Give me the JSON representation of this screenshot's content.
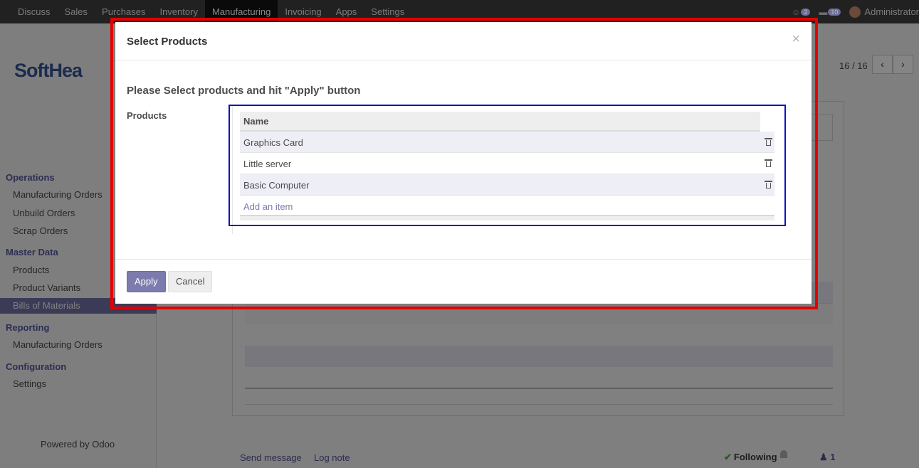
{
  "topbar": {
    "menu": [
      "Discuss",
      "Sales",
      "Purchases",
      "Inventory",
      "Manufacturing",
      "Invoicing",
      "Apps",
      "Settings"
    ],
    "active": "Manufacturing",
    "chat_count": "2",
    "activity_count": "10",
    "user": "Administrator"
  },
  "sidebar": {
    "logo": "SoftHea",
    "sections": [
      {
        "title": "Operations",
        "items": [
          "Manufacturing Orders",
          "Unbuild Orders",
          "Scrap Orders"
        ]
      },
      {
        "title": "Master Data",
        "items": [
          "Products",
          "Product Variants",
          "Bills of Materials"
        ]
      },
      {
        "title": "Reporting",
        "items": [
          "Manufacturing Orders"
        ]
      },
      {
        "title": "Configuration",
        "items": [
          "Settings"
        ]
      }
    ],
    "active_item": "Bills of Materials",
    "powered_by": "Powered by Odoo"
  },
  "pager": {
    "text": "16 / 16",
    "prev_icon": "chevron-left-icon",
    "next_icon": "chevron-right-icon"
  },
  "chatter": {
    "send_message": "Send message",
    "log_note": "Log note",
    "following": "Following",
    "followers": "1"
  },
  "modal": {
    "title": "Select Products",
    "close": "×",
    "instruction": "Please Select products and hit \"Apply\" button",
    "field_label": "Products",
    "column_header": "Name",
    "rows": [
      "Graphics Card",
      "Little server",
      "Basic Computer"
    ],
    "add_item": "Add an item",
    "apply": "Apply",
    "cancel": "Cancel"
  },
  "colors": {
    "primary": "#7c7bad",
    "highlight_red": "#e50000",
    "highlight_blue": "#1010c8"
  }
}
